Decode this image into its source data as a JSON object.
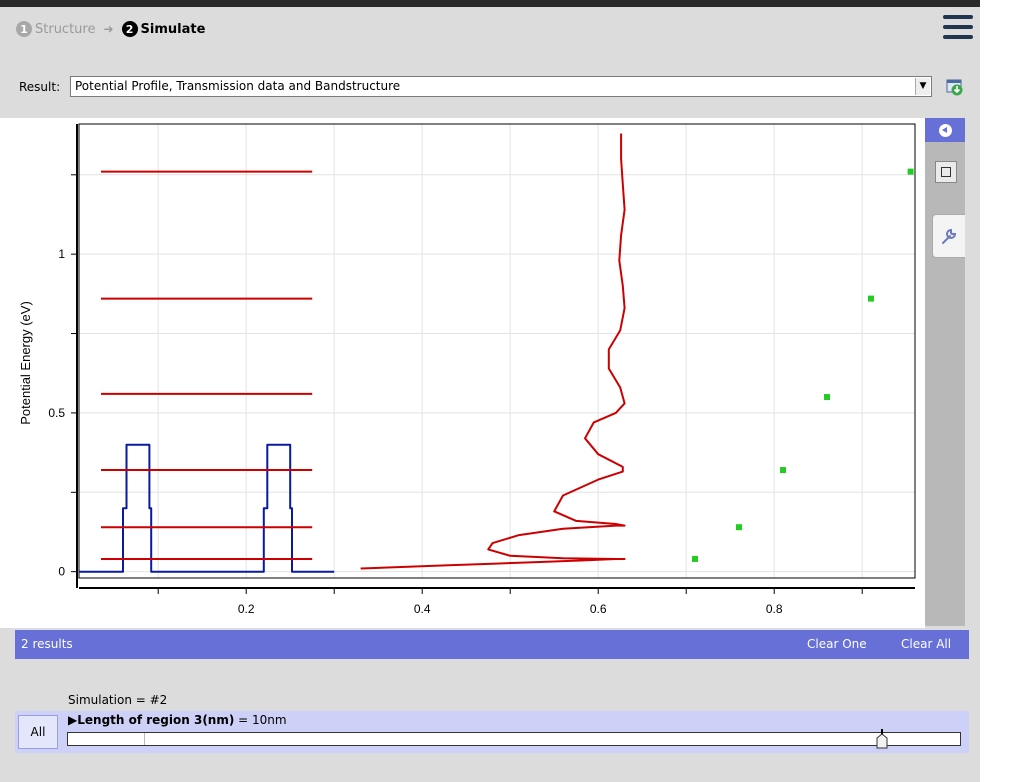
{
  "header": {
    "steps": [
      {
        "number": "1",
        "label": "Structure",
        "state": "inactive"
      },
      {
        "number": "2",
        "label": "Simulate",
        "state": "active"
      }
    ],
    "arrow": "➜",
    "menu_icon": "hamburger-menu-icon"
  },
  "result": {
    "label": "Result:",
    "selected": "Potential Profile, Transmission data and Bandstructure"
  },
  "chart_data": {
    "type": "line",
    "ylabel": "Potential Energy (eV)",
    "xlabel": "",
    "title": "",
    "xlim": [
      0.01,
      0.96
    ],
    "ylim": [
      -0.02,
      1.41
    ],
    "x_ticks": [
      "0.2",
      "0.4",
      "0.6",
      "0.8"
    ],
    "y_ticks": [
      "0",
      "0.5",
      "1"
    ],
    "grid": true,
    "series": [
      {
        "color": "#0a1aa0",
        "kind": "potential-profile",
        "points": [
          [
            0.01,
            0.0
          ],
          [
            0.06,
            0.0
          ],
          [
            0.06,
            0.2
          ],
          [
            0.064,
            0.2
          ],
          [
            0.064,
            0.4
          ],
          [
            0.09,
            0.4
          ],
          [
            0.09,
            0.2
          ],
          [
            0.092,
            0.2
          ],
          [
            0.092,
            0.0
          ],
          [
            0.22,
            0.0
          ],
          [
            0.22,
            0.2
          ],
          [
            0.224,
            0.2
          ],
          [
            0.224,
            0.4
          ],
          [
            0.25,
            0.4
          ],
          [
            0.25,
            0.2
          ],
          [
            0.252,
            0.2
          ],
          [
            0.252,
            0.0
          ],
          [
            0.3,
            0.0
          ]
        ]
      },
      {
        "color": "#cc0000",
        "kind": "energy-levels",
        "x_range": [
          0.035,
          0.275
        ],
        "levels": [
          0.04,
          0.14,
          0.32,
          0.56,
          0.86,
          1.26
        ]
      },
      {
        "color": "#cc0000",
        "kind": "transmission",
        "points": [
          [
            0.33,
            0.01
          ],
          [
            0.38,
            0.015
          ],
          [
            0.43,
            0.02
          ],
          [
            0.48,
            0.025
          ],
          [
            0.53,
            0.03
          ],
          [
            0.58,
            0.035
          ],
          [
            0.62,
            0.04
          ],
          [
            0.63,
            0.04
          ],
          [
            0.62,
            0.04
          ],
          [
            0.56,
            0.042
          ],
          [
            0.5,
            0.05
          ],
          [
            0.475,
            0.07
          ],
          [
            0.48,
            0.09
          ],
          [
            0.51,
            0.115
          ],
          [
            0.56,
            0.135
          ],
          [
            0.62,
            0.145
          ],
          [
            0.63,
            0.145
          ],
          [
            0.62,
            0.15
          ],
          [
            0.575,
            0.16
          ],
          [
            0.55,
            0.19
          ],
          [
            0.56,
            0.24
          ],
          [
            0.6,
            0.29
          ],
          [
            0.628,
            0.315
          ],
          [
            0.628,
            0.33
          ],
          [
            0.6,
            0.37
          ],
          [
            0.585,
            0.42
          ],
          [
            0.595,
            0.47
          ],
          [
            0.62,
            0.5
          ],
          [
            0.63,
            0.53
          ],
          [
            0.625,
            0.58
          ],
          [
            0.612,
            0.64
          ],
          [
            0.612,
            0.7
          ],
          [
            0.625,
            0.76
          ],
          [
            0.63,
            0.83
          ],
          [
            0.628,
            0.9
          ],
          [
            0.624,
            0.98
          ],
          [
            0.626,
            1.06
          ],
          [
            0.63,
            1.14
          ],
          [
            0.628,
            1.22
          ],
          [
            0.626,
            1.3
          ],
          [
            0.626,
            1.38
          ]
        ]
      },
      {
        "color": "#22cc22",
        "kind": "bandstructure",
        "points": [
          [
            0.71,
            0.04
          ],
          [
            0.76,
            0.14
          ],
          [
            0.81,
            0.32
          ],
          [
            0.86,
            0.55
          ],
          [
            0.91,
            0.86
          ],
          [
            0.955,
            1.26
          ]
        ]
      }
    ]
  },
  "side_panel": {
    "collapse_icon": "collapse-left-icon",
    "button_icon": "square-icon",
    "tab_icon": "wrench-icon"
  },
  "results_bar": {
    "count": "2 results",
    "clear_one": "Clear One",
    "clear_all": "Clear All"
  },
  "simulation": {
    "label": "Simulation = #2",
    "all_button": "All",
    "param_name": "Length of region 3(nm)",
    "param_value": " = 10nm",
    "slider_value": 0.91
  }
}
